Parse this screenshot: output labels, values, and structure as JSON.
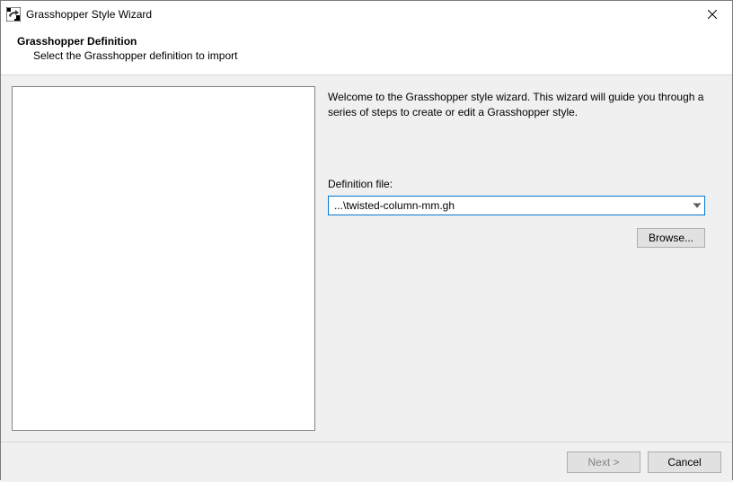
{
  "window": {
    "title": "Grasshopper Style Wizard"
  },
  "header": {
    "title": "Grasshopper Definition",
    "subtitle": "Select the Grasshopper definition to import"
  },
  "main": {
    "intro": "Welcome to the Grasshopper style wizard. This wizard will guide you through a series of steps to create or edit a Grasshopper style.",
    "definition_label": "Definition file:",
    "definition_value": "...\\twisted-column-mm.gh",
    "browse_label": "Browse..."
  },
  "footer": {
    "next_label": "Next >",
    "cancel_label": "Cancel"
  }
}
